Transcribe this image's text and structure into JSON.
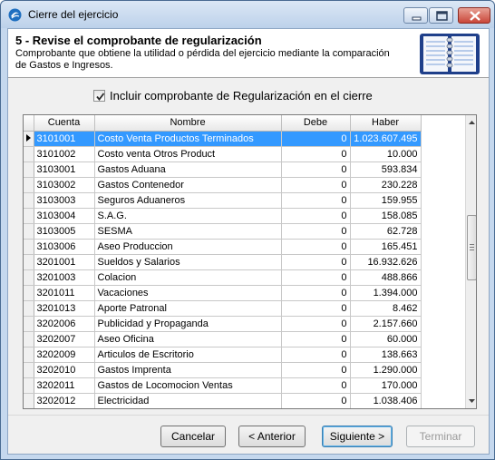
{
  "window": {
    "title": "Cierre del ejercicio"
  },
  "header": {
    "title": "5 - Revise el comprobante de regularización",
    "description": "Comprobante que obtiene la utilidad o pérdida del ejercicio mediante la comparación de Gastos e Ingresos."
  },
  "option": {
    "include_label": "Incluir comprobante de Regularización en el cierre",
    "include_checked": true
  },
  "grid": {
    "columns": [
      "Cuenta",
      "Nombre",
      "Debe",
      "Haber"
    ],
    "rows": [
      {
        "cuenta": "3101001",
        "nombre": "Costo Venta Productos Terminados",
        "debe": "0",
        "haber": "1.023.607.495",
        "selected": true
      },
      {
        "cuenta": "3101002",
        "nombre": "Costo venta Otros Product",
        "debe": "0",
        "haber": "10.000"
      },
      {
        "cuenta": "3103001",
        "nombre": "Gastos Aduana",
        "debe": "0",
        "haber": "593.834"
      },
      {
        "cuenta": "3103002",
        "nombre": "Gastos Contenedor",
        "debe": "0",
        "haber": "230.228"
      },
      {
        "cuenta": "3103003",
        "nombre": "Seguros Aduaneros",
        "debe": "0",
        "haber": "159.955"
      },
      {
        "cuenta": "3103004",
        "nombre": "S.A.G.",
        "debe": "0",
        "haber": "158.085"
      },
      {
        "cuenta": "3103005",
        "nombre": "SESMA",
        "debe": "0",
        "haber": "62.728"
      },
      {
        "cuenta": "3103006",
        "nombre": "Aseo Produccion",
        "debe": "0",
        "haber": "165.451"
      },
      {
        "cuenta": "3201001",
        "nombre": "Sueldos y Salarios",
        "debe": "0",
        "haber": "16.932.626"
      },
      {
        "cuenta": "3201003",
        "nombre": "Colacion",
        "debe": "0",
        "haber": "488.866"
      },
      {
        "cuenta": "3201011",
        "nombre": "Vacaciones",
        "debe": "0",
        "haber": "1.394.000"
      },
      {
        "cuenta": "3201013",
        "nombre": "Aporte Patronal",
        "debe": "0",
        "haber": "8.462"
      },
      {
        "cuenta": "3202006",
        "nombre": "Publicidad y Propaganda",
        "debe": "0",
        "haber": "2.157.660"
      },
      {
        "cuenta": "3202007",
        "nombre": "Aseo Oficina",
        "debe": "0",
        "haber": "60.000"
      },
      {
        "cuenta": "3202009",
        "nombre": "Articulos de Escritorio",
        "debe": "0",
        "haber": "138.663"
      },
      {
        "cuenta": "3202010",
        "nombre": "Gastos Imprenta",
        "debe": "0",
        "haber": "1.290.000"
      },
      {
        "cuenta": "3202011",
        "nombre": "Gastos de Locomocion Ventas",
        "debe": "0",
        "haber": "170.000"
      },
      {
        "cuenta": "3202012",
        "nombre": "Electricidad",
        "debe": "0",
        "haber": "1.038.406"
      }
    ]
  },
  "buttons": {
    "cancel": "Cancelar",
    "prev": "< Anterior",
    "next": "Siguiente >",
    "finish": "Terminar"
  },
  "colors": {
    "selection": "#3399ff",
    "window_frame": "#c5d8ee"
  },
  "icons": {
    "app": "app-logo-icon",
    "minimize": "minimize-icon",
    "maximize": "maximize-icon",
    "close": "close-icon",
    "header_graphic": "ledger-book-icon",
    "row_pointer": "row-pointer-icon"
  }
}
